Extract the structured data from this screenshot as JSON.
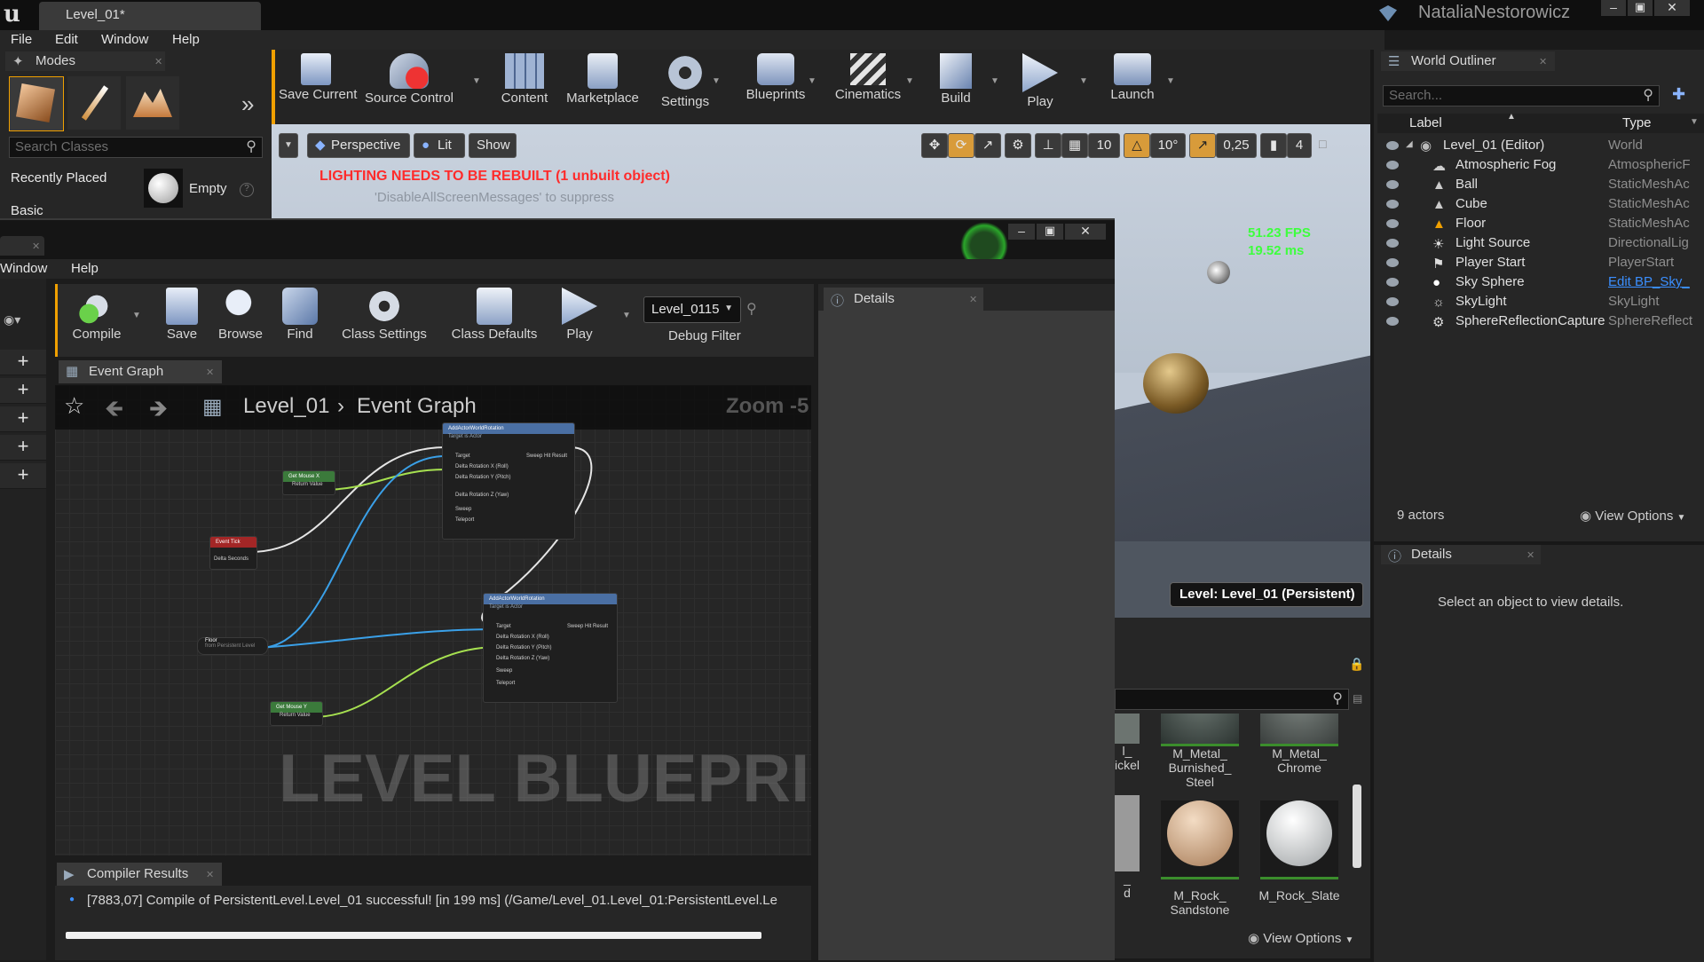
{
  "app": {
    "level_tab": "Level_01*",
    "user": "NataliaNestorowicz",
    "colors": {
      "accent": "#f0a000",
      "warning": "#ff2b2b",
      "fps": "#3dff3d",
      "link": "#3b8fff"
    }
  },
  "menu": [
    "File",
    "Edit",
    "Window",
    "Help"
  ],
  "modes": {
    "tab": "Modes",
    "search_placeholder": "Search Classes",
    "categories": [
      "Recently Placed",
      "Basic"
    ],
    "placed_item": "Empty",
    "mode_icons": [
      "place-mode-icon",
      "paint-mode-icon",
      "landscape-mode-icon"
    ]
  },
  "toolbar": [
    {
      "label": "Save Current",
      "icon": "save-icon"
    },
    {
      "label": "Source Control",
      "icon": "source-control-icon"
    },
    {
      "label": "Content",
      "icon": "content-icon"
    },
    {
      "label": "Marketplace",
      "icon": "marketplace-icon"
    },
    {
      "label": "Settings",
      "icon": "settings-icon"
    },
    {
      "label": "Blueprints",
      "icon": "blueprints-icon"
    },
    {
      "label": "Cinematics",
      "icon": "cinematics-icon"
    },
    {
      "label": "Build",
      "icon": "build-icon"
    },
    {
      "label": "Play",
      "icon": "play-icon"
    },
    {
      "label": "Launch",
      "icon": "launch-icon"
    }
  ],
  "viewport": {
    "perspective": "Perspective",
    "lit": "Lit",
    "show": "Show",
    "grid_snap": "10",
    "rot_snap": "10°",
    "scale_snap": "0,25",
    "cam_speed": "4",
    "warning": "LIGHTING NEEDS TO BE REBUILT (1 unbuilt object)",
    "suppress": "'DisableAllScreenMessages' to suppress",
    "fps": "51.23 FPS",
    "ms": "19.52 ms",
    "level_label": "Level:  Level_01 (Persistent)"
  },
  "outliner": {
    "tab": "World Outliner",
    "search_placeholder": "Search...",
    "col_label": "Label",
    "col_type": "Type",
    "rows": [
      {
        "name": "Level_01 (Editor)",
        "type": "World"
      },
      {
        "name": "Atmospheric Fog",
        "type": "AtmosphericF"
      },
      {
        "name": "Ball",
        "type": "StaticMeshAc"
      },
      {
        "name": "Cube",
        "type": "StaticMeshAc"
      },
      {
        "name": "Floor",
        "type": "StaticMeshAc"
      },
      {
        "name": "Light Source",
        "type": "DirectionalLig"
      },
      {
        "name": "Player Start",
        "type": "PlayerStart"
      },
      {
        "name": "Sky Sphere",
        "type": "Edit BP_Sky_"
      },
      {
        "name": "SkyLight",
        "type": "SkyLight"
      },
      {
        "name": "SphereReflectionCapture",
        "type": "SphereReflect"
      }
    ],
    "count": "9 actors",
    "view_options": "View Options"
  },
  "right_details": {
    "tab": "Details",
    "empty": "Select an object to view details."
  },
  "blueprint": {
    "menu": [
      "Window",
      "Help"
    ],
    "tools": [
      {
        "label": "Compile",
        "icon": "compile-icon"
      },
      {
        "label": "Save",
        "icon": "save-icon"
      },
      {
        "label": "Browse",
        "icon": "browse-icon"
      },
      {
        "label": "Find",
        "icon": "find-icon"
      },
      {
        "label": "Class Settings",
        "icon": "class-settings-icon"
      },
      {
        "label": "Class Defaults",
        "icon": "class-defaults-icon"
      },
      {
        "label": "Play",
        "icon": "play-icon"
      }
    ],
    "debug_object": "Level_0115",
    "debug_filter": "Debug Filter",
    "details_tab": "Details",
    "graph_tab": "Event Graph",
    "breadcrumb_root": "Level_01",
    "breadcrumb_leaf": "Event Graph",
    "zoom": "Zoom -5",
    "watermark": "LEVEL BLUEPRINT",
    "compiler_tab": "Compiler Results",
    "compiler_msg": "[7883,07] Compile of PersistentLevel.Level_01 successful! [in 199 ms] (/Game/Level_01.Level_01:PersistentLevel.Le",
    "nodes": {
      "rot1_title": "AddActorWorldRotation",
      "rot1_sub": "Target is Actor",
      "rot2_title": "AddActorWorldRotation",
      "rot2_sub": "Target is Actor",
      "mouse_x": "Get Mouse X",
      "mouse_y": "Get Mouse Y",
      "tick": "Event Tick",
      "delta": "Delta Seconds",
      "floor": "Floor",
      "floor_sub": "from Persistent Level",
      "target": "Target",
      "sweep_hit": "Sweep Hit Result",
      "roll": "Delta Rotation X (Roll)",
      "pitch": "Delta Rotation Y (Pitch)",
      "yaw": "Delta Rotation Z (Yaw)",
      "sweep": "Sweep",
      "teleport": "Teleport",
      "return_value": "Return Value"
    }
  },
  "content": {
    "assets": [
      {
        "name": "l_\nickel",
        "color": "#6c7470"
      },
      {
        "name": "M_Metal_\nBurnished_\nSteel",
        "color": "#4b5550"
      },
      {
        "name": "M_Metal_\nChrome",
        "color": "#5a605e"
      },
      {
        "name": "_\nd",
        "color": "#9a9a9a"
      },
      {
        "name": "M_Rock_\nSandstone",
        "color": "#c9a98a"
      },
      {
        "name": "M_Rock_Slate",
        "color": "#d8d8d8"
      }
    ],
    "view_options": "View Options"
  }
}
